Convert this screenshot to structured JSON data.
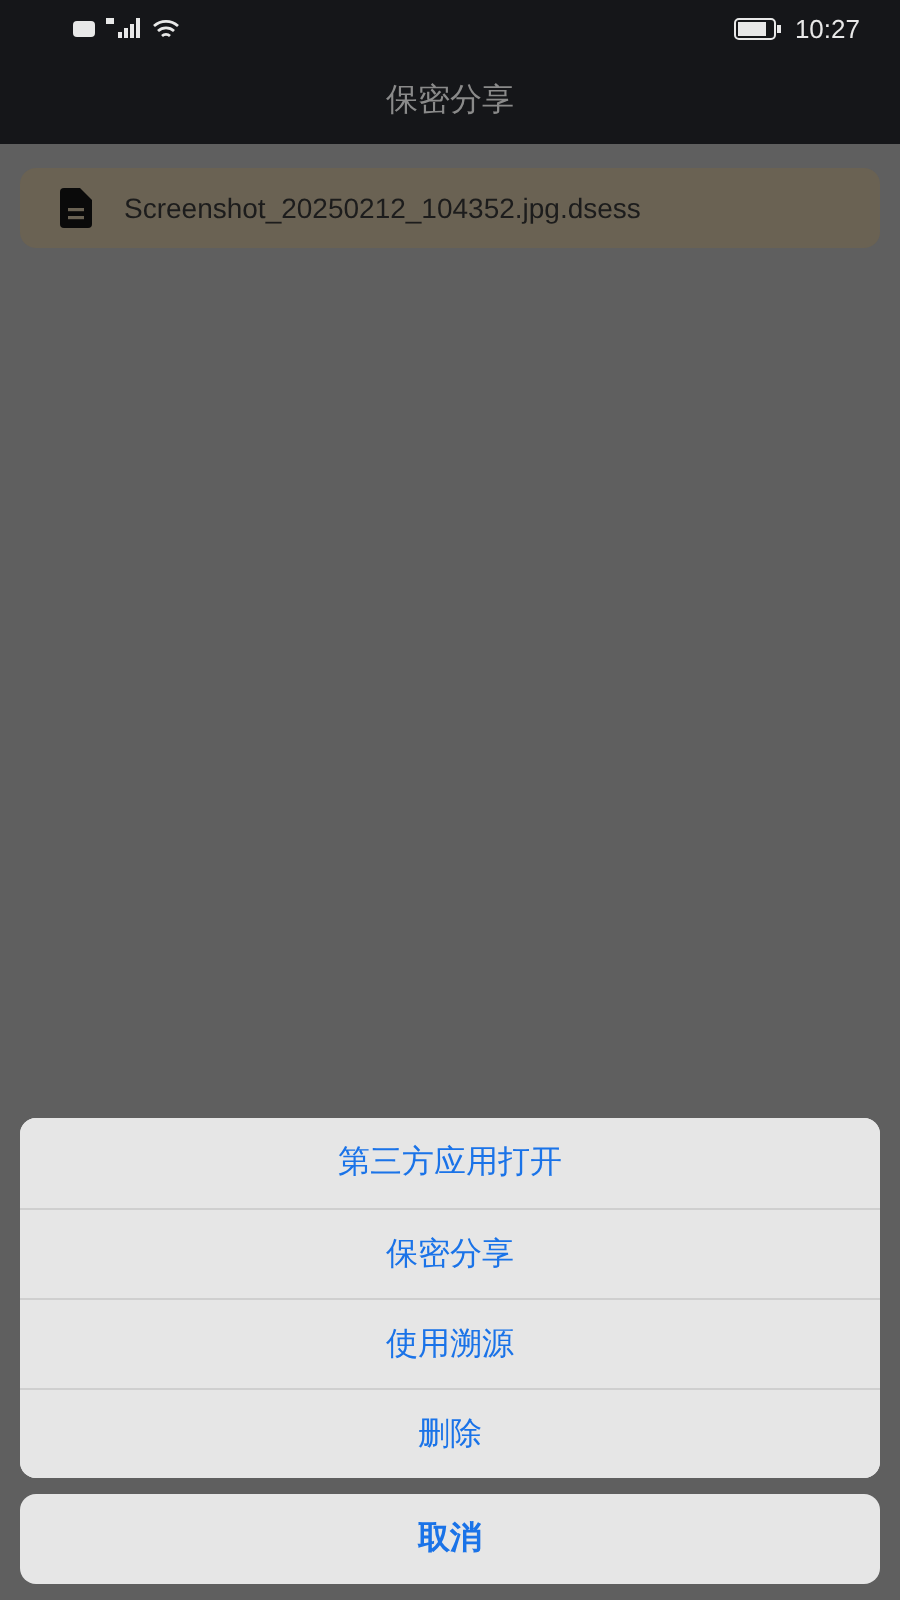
{
  "status_bar": {
    "time": "10:27"
  },
  "header": {
    "title": "保密分享"
  },
  "files": [
    {
      "name": "Screenshot_20250212_104352.jpg.dsess"
    }
  ],
  "action_sheet": {
    "actions": [
      "第三方应用打开",
      "保密分享",
      "使用溯源",
      "删除"
    ],
    "cancel": "取消"
  }
}
